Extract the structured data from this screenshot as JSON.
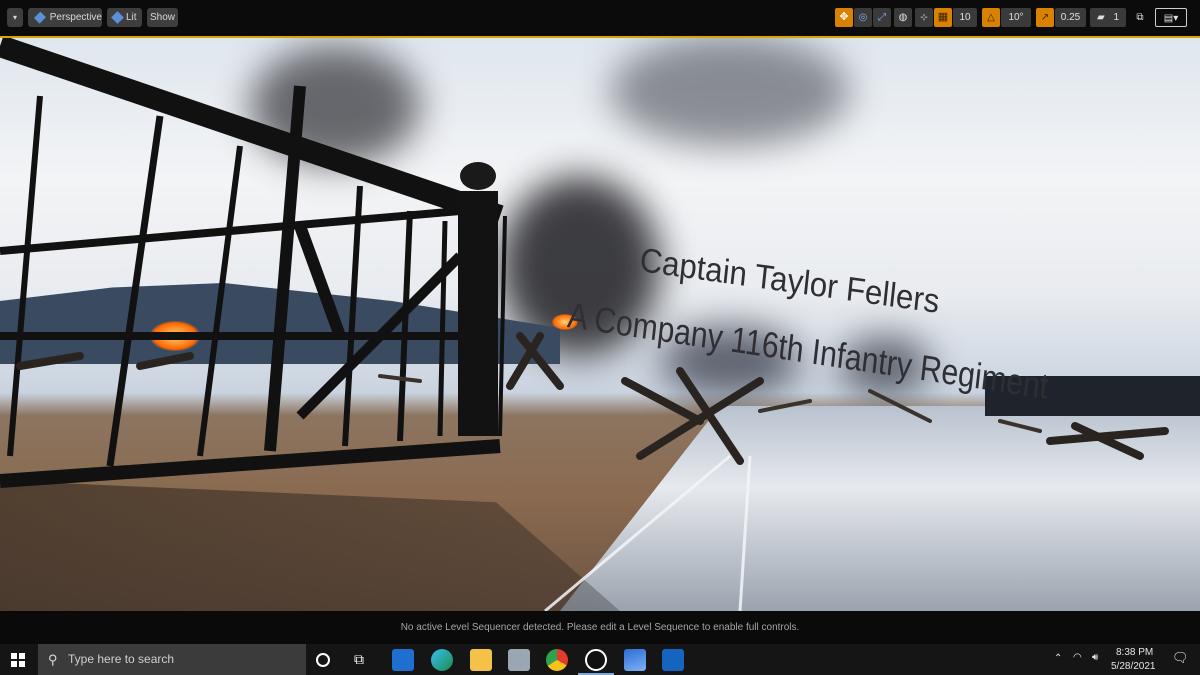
{
  "toolbar": {
    "view_mode_label": "Perspective",
    "lighting_label": "Lit",
    "show_label": "Show",
    "grid_snap_value": "10",
    "rotation_snap_value": "10°",
    "scale_snap_value": "0.25",
    "camera_speed_value": "1"
  },
  "viewport": {
    "caption_line1": "Captain Taylor Fellers",
    "caption_line2": "A Company 116th Infantry Regiment"
  },
  "status": {
    "message": "No active Level Sequencer detected. Please edit a Level Sequence to enable full controls."
  },
  "taskbar": {
    "search_placeholder": "Type here to search",
    "time": "8:38 PM",
    "date": "5/28/2021",
    "apps": [
      "task-view-icon",
      "mail-icon",
      "edge-icon",
      "file-explorer-icon",
      "photos-viewer-icon",
      "chrome-icon",
      "unreal-engine-icon",
      "photos-icon",
      "movies-icon"
    ]
  }
}
